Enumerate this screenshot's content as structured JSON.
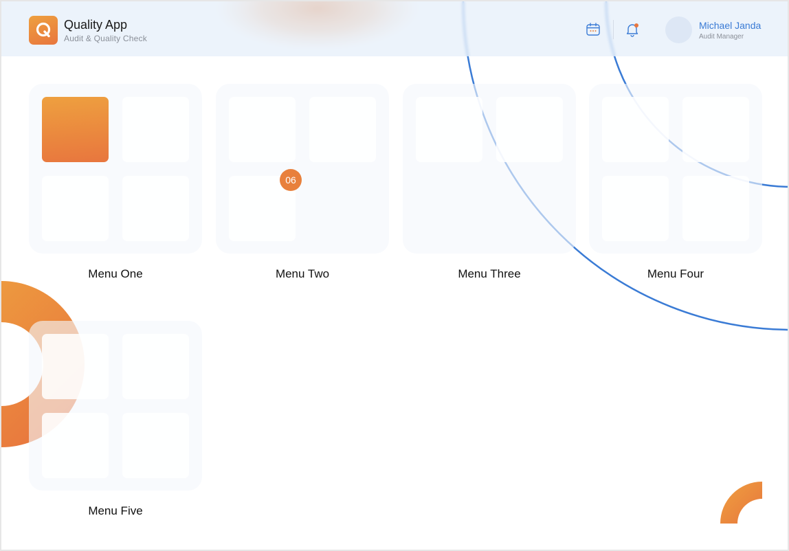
{
  "colors": {
    "accent_orange": "#e8803c",
    "accent_blue": "#3a7bd5",
    "header_bg": "#e4eefa",
    "card_bg": "#f3f7fc"
  },
  "header": {
    "logo_letter": "Q",
    "app_title": "Quality App",
    "app_subtitle": "Audit & Quality Check",
    "icons": [
      "calendar-icon",
      "bell-icon"
    ],
    "user": {
      "name": "Michael Janda",
      "role": "Audit Manager"
    }
  },
  "menus": [
    {
      "label": "Menu One",
      "filled_tiles": 4,
      "highlighted_tile": 1
    },
    {
      "label": "Menu Two",
      "filled_tiles": 3,
      "badge": "06"
    },
    {
      "label": "Menu Three",
      "filled_tiles": 2
    },
    {
      "label": "Menu Four",
      "filled_tiles": 4
    },
    {
      "label": "Menu Five",
      "filled_tiles": 4
    }
  ]
}
